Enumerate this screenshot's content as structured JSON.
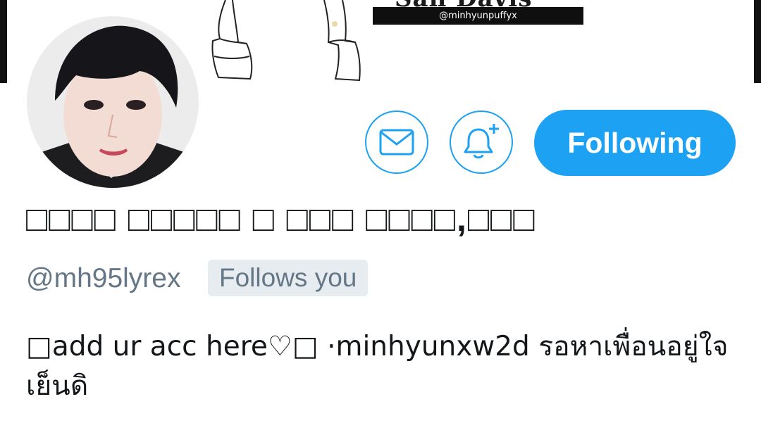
{
  "banner": {
    "title_fragment": "San Davis",
    "handle_strip": "@minhyunpuffyx"
  },
  "profile": {
    "display_name": "□□□□ □□□□□ □ □□□ □□□□,□□□",
    "handle": "@mh95lyrex",
    "follows_you_badge": "Follows you",
    "bio": "□add ur acc here♡□ ·minhyunxw2d รอหาเพื่อนอยู่ใจเย็นดิ"
  },
  "actions": {
    "message_icon": "envelope-icon",
    "notify_icon": "bell-plus-icon",
    "follow_label": "Following"
  },
  "colors": {
    "accent": "#1da1f2",
    "secondary_text": "#657786",
    "badge_bg": "#e6ecf0",
    "primary_text": "#14171a"
  }
}
